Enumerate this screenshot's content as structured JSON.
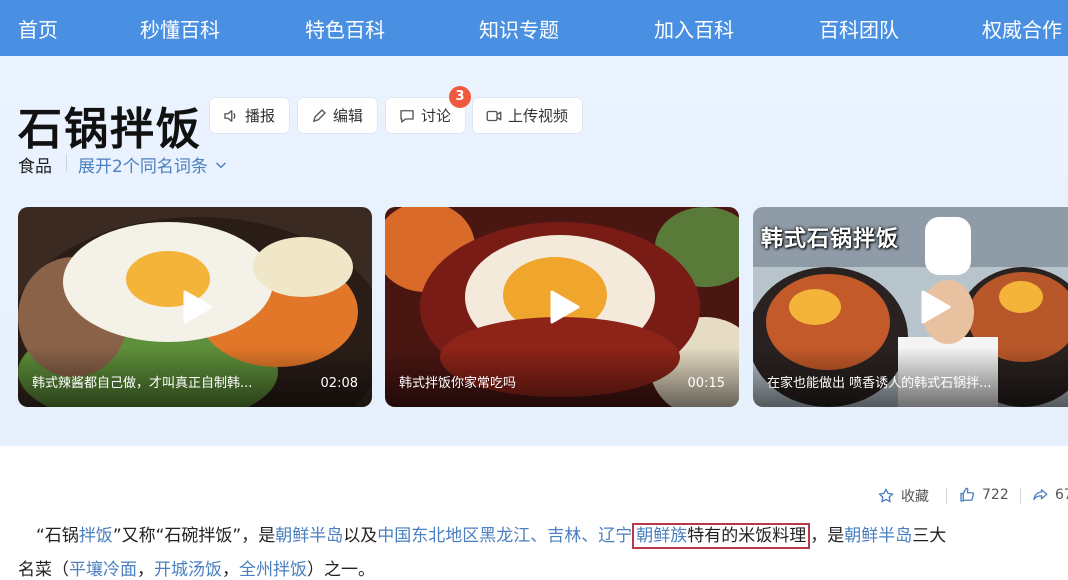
{
  "nav": {
    "items": [
      "首页",
      "秒懂百科",
      "特色百科",
      "知识专题",
      "加入百科",
      "百科团队",
      "权威合作"
    ]
  },
  "header": {
    "title": "石锅拌饭",
    "toolbar": {
      "broadcast": "播报",
      "edit": "编辑",
      "discuss": "讨论",
      "discuss_badge": "3",
      "upload_video": "上传视频"
    },
    "category": "食品",
    "expand_label": "展开2个同名词条"
  },
  "videos": [
    {
      "caption": "韩式辣酱都自己做，才叫真正自制韩...",
      "duration": "02:08"
    },
    {
      "caption": "韩式拌饭你家常吃吗",
      "duration": "00:15"
    },
    {
      "caption": "在家也能做出 喷香诱人的韩式石锅拌...",
      "duration": "",
      "overlay_title": "韩式石锅拌饭"
    }
  ],
  "stats": {
    "favorite": "收藏",
    "likes": "722",
    "share": "67"
  },
  "article": {
    "line1": {
      "t1": "“石锅",
      "l1": "拌饭",
      "t2": "”又称“石碗拌饭”，是",
      "l2": "朝鲜半岛",
      "t3": "以及",
      "l3": "中国东北地区",
      "l4": "黑龙江",
      "t4": "、",
      "l5": "吉林",
      "t5": "、",
      "l6": "辽宁",
      "h_link": "朝鲜族",
      "h_text": "特有的米饭料理",
      "t6": "，是",
      "l7": "朝鲜半岛",
      "t7": "三大"
    },
    "line2": {
      "t1": "名菜（",
      "l1": "平壤冷面",
      "t2": "，",
      "l2": "开城汤饭",
      "t3": "，",
      "l3": "全州拌饭",
      "t4": "）之一。"
    }
  },
  "colors": {
    "nav_bg": "#4a90e2",
    "link": "#4a7fc0",
    "badge": "#f05a3c",
    "highlight_border": "#b5394a"
  }
}
